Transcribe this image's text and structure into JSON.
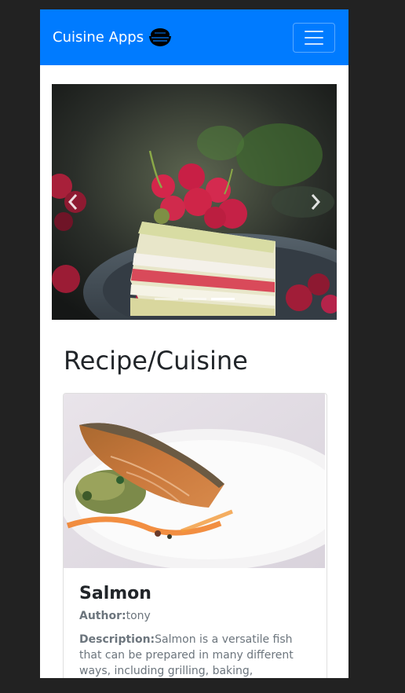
{
  "navbar": {
    "brand": "Cuisine Apps",
    "brand_icon": "rice-bowl-icon",
    "toggle_icon": "hamburger-menu-icon",
    "color": "#007bff"
  },
  "carousel": {
    "image": "raspberry-cake-slice",
    "prev_icon": "chevron-left-icon",
    "next_icon": "chevron-right-icon",
    "slide_count": 3,
    "active_slide": 3
  },
  "section": {
    "title": "Recipe/Cuisine"
  },
  "recipe": {
    "image": "salmon-fillet-plate",
    "title": "Salmon",
    "author_label": "Author:",
    "author": "tony",
    "description_label": "Description:",
    "description": "Salmon is a versatile fish that can be prepared in many different ways, including grilling, baking,"
  }
}
